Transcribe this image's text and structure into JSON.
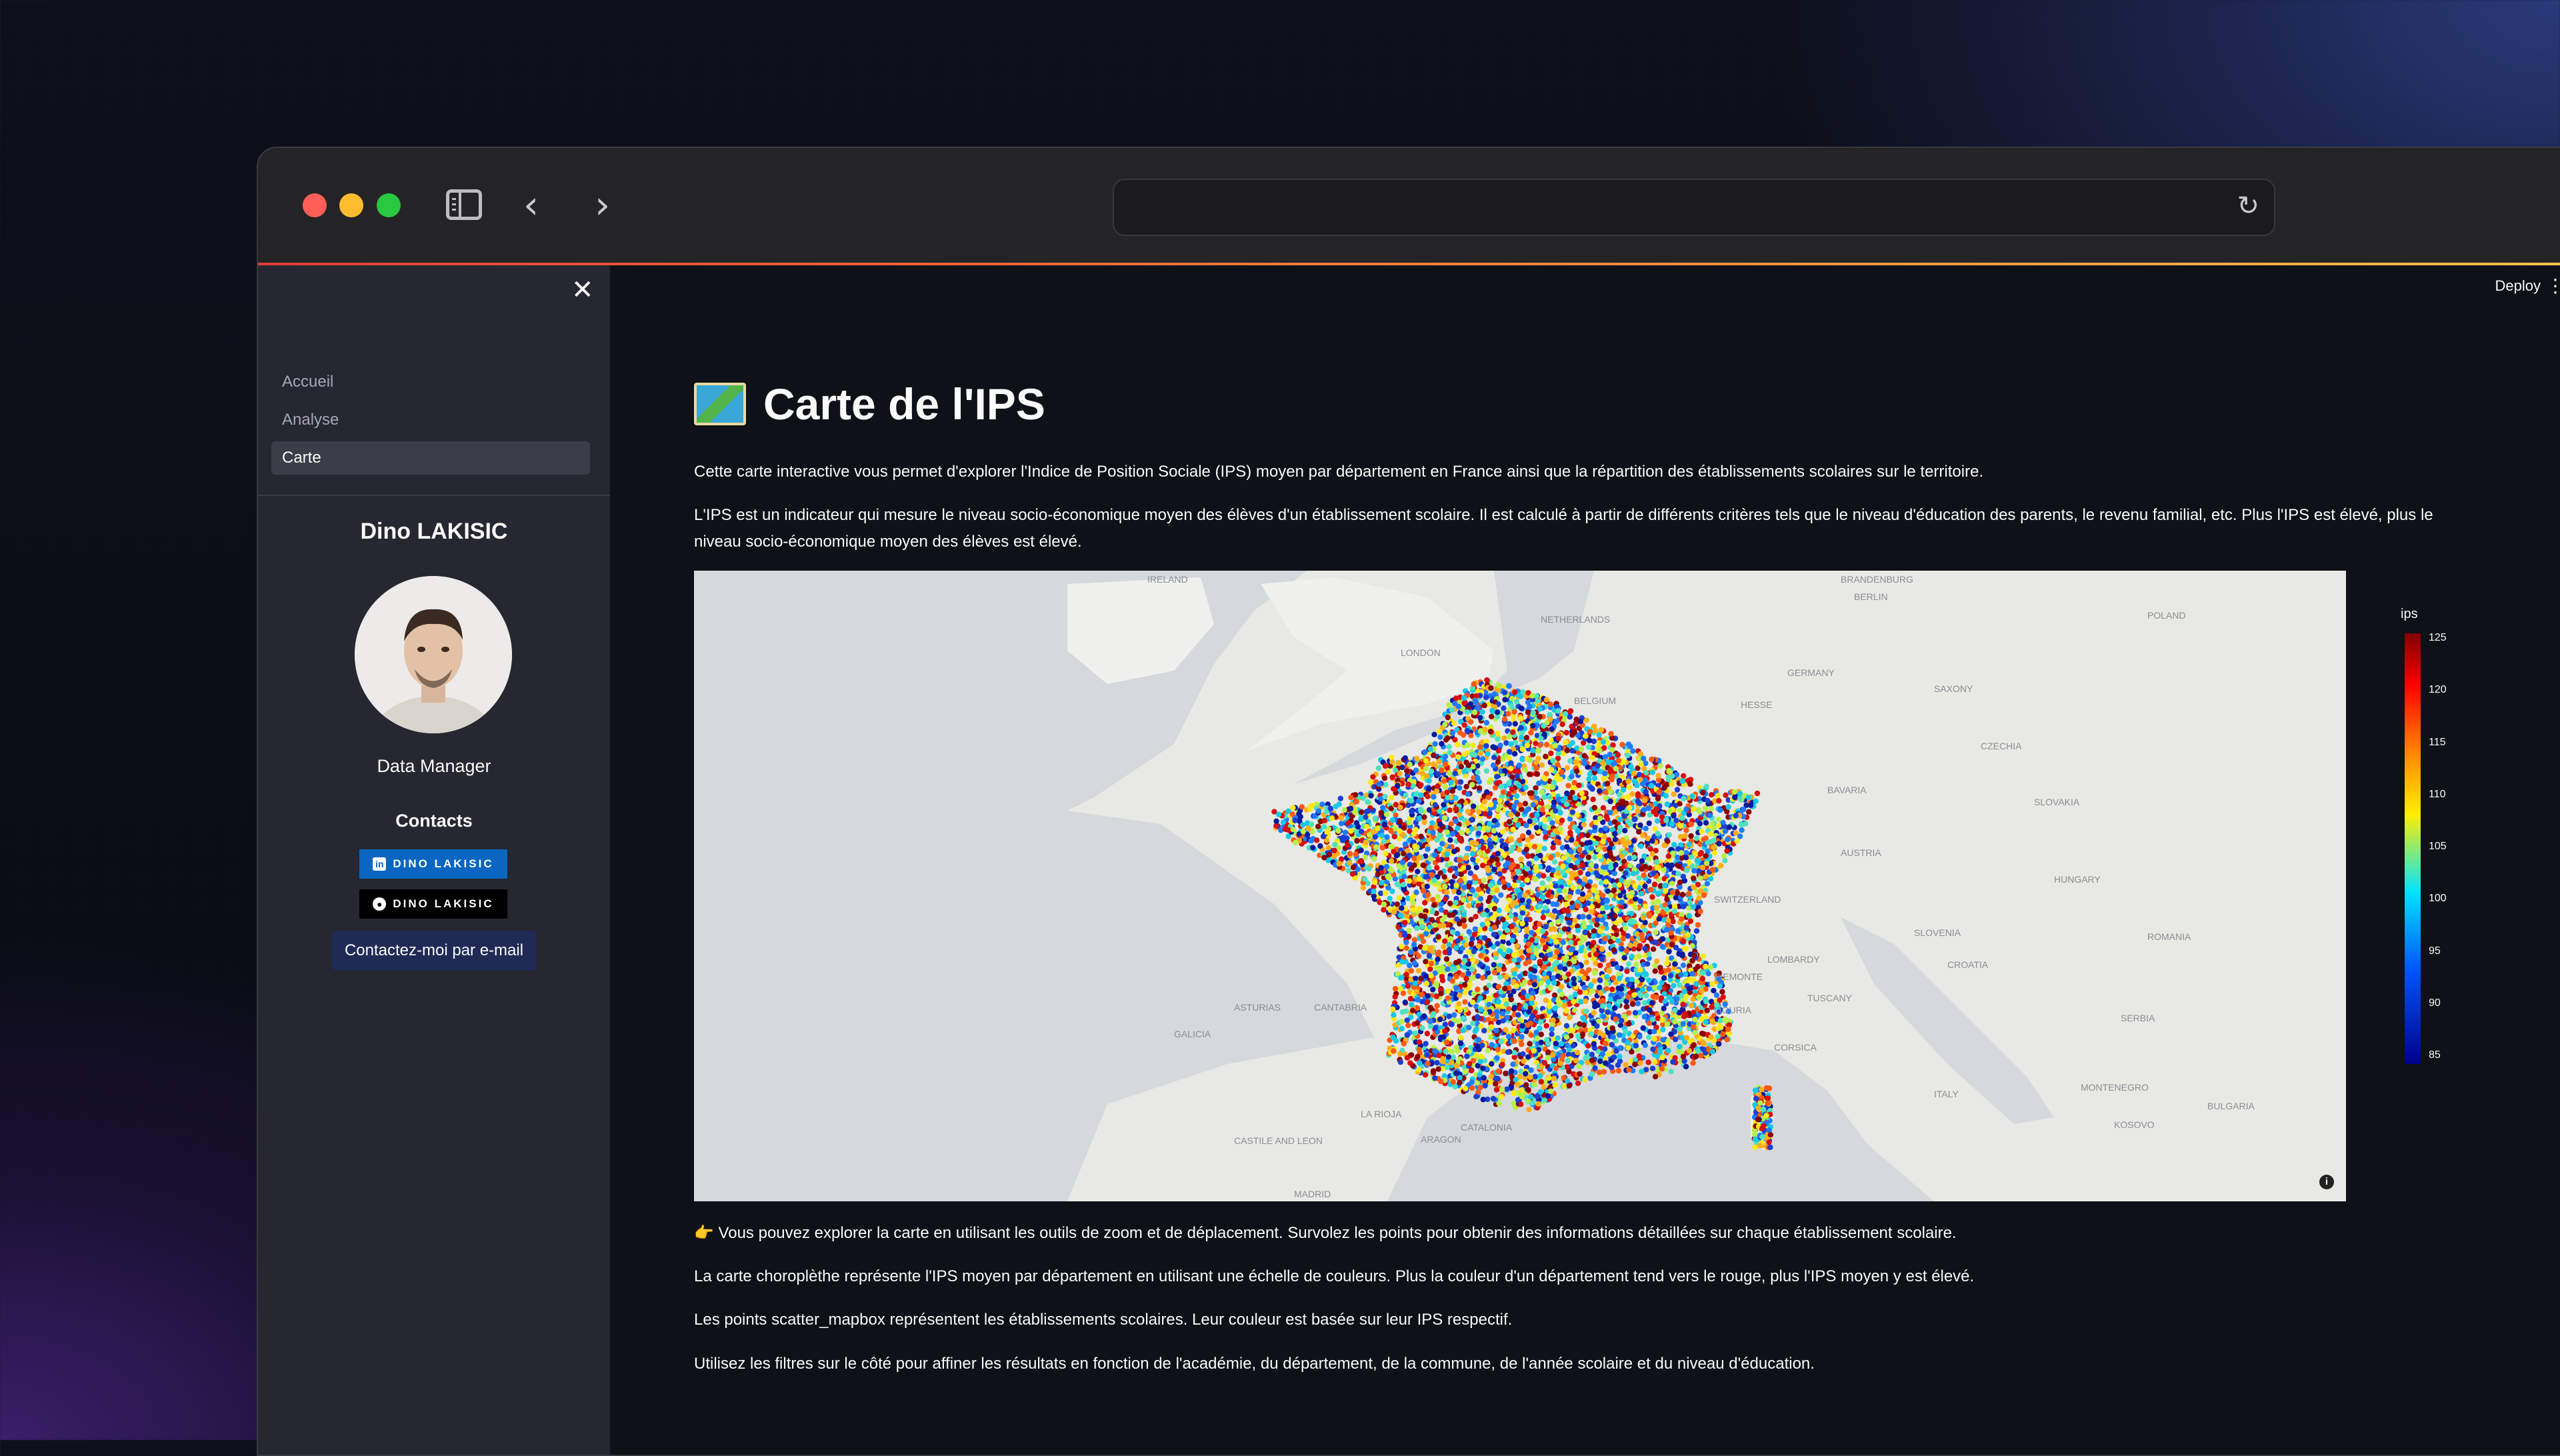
{
  "browser": {
    "nav_back": "‹",
    "nav_forward": "›",
    "reload_icon": "↻"
  },
  "sidebar": {
    "close": "✕",
    "items": [
      {
        "label": "Accueil",
        "active": false
      },
      {
        "label": "Analyse",
        "active": false
      },
      {
        "label": "Carte",
        "active": true
      }
    ],
    "profile": {
      "name": "Dino LAKISIC",
      "role": "Data Manager",
      "contacts_title": "Contacts",
      "linkedin_badge": "DINO LAKISIC",
      "github_badge": "DINO LAKISIC",
      "email_button": "Contactez-moi par e-mail"
    }
  },
  "header": {
    "deploy": "Deploy",
    "menu": "⋮"
  },
  "main": {
    "title": "Carte de l'IPS",
    "intro": "Cette carte interactive vous permet d'explorer l'Indice de Position Sociale (IPS) moyen par département en France ainsi que la répartition des établissements scolaires sur le territoire.",
    "definition": "L'IPS est un indicateur qui mesure le niveau socio-économique moyen des élèves d'un établissement scolaire. Il est calculé à partir de différents critères tels que le niveau d'éducation des parents, le revenu familial, etc. Plus l'IPS est élevé, plus le niveau socio-économique moyen des élèves est élevé.",
    "hint": "👉 Vous pouvez explorer la carte en utilisant les outils de zoom et de déplacement. Survolez les points pour obtenir des informations détaillées sur chaque établissement scolaire.",
    "choropleth": "La carte choroplèthe représente l'IPS moyen par département en utilisant une échelle de couleurs. Plus la couleur d'un département tend vers le rouge, plus l'IPS moyen y est élevé.",
    "scatter": "Les points scatter_mapbox représentent les établissements scolaires. Leur couleur est basée sur leur IPS respectif.",
    "filters": "Utilisez les filtres sur le côté pour affiner les résultats en fonction de l'académie, du département, de la commune, de l'année scolaire et du niveau d'éducation."
  },
  "map": {
    "colorbar_title": "ips",
    "ticks": [
      "125",
      "120",
      "115",
      "110",
      "105",
      "100",
      "95",
      "90",
      "85"
    ],
    "labels": [
      "IRELAND",
      "LONDON",
      "NETHERLANDS",
      "BELGIUM",
      "GERMANY",
      "HESSE",
      "SAXONY",
      "BAVARIA",
      "CZECHIA",
      "AUSTRIA",
      "SWITZERLAND",
      "SLOVENIA",
      "CROATIA",
      "HUNGARY",
      "ROMANIA",
      "SERBIA",
      "BULGARIA",
      "ITALY",
      "CATALONIA",
      "LA RIOJA",
      "ARAGON",
      "ASTURIAS",
      "CANTABRIA",
      "GALICIA",
      "CASTILE AND LEON",
      "LOMBARDY",
      "TUSCANY",
      "POLAND",
      "SLOVAKIA",
      "BRANDENBURG",
      "BERLIN",
      "KOSOVO",
      "MONTENEGRO",
      "PIEMONTE",
      "LIGURIA",
      "MADRID",
      "CORSICA"
    ],
    "info_icon": "i"
  }
}
